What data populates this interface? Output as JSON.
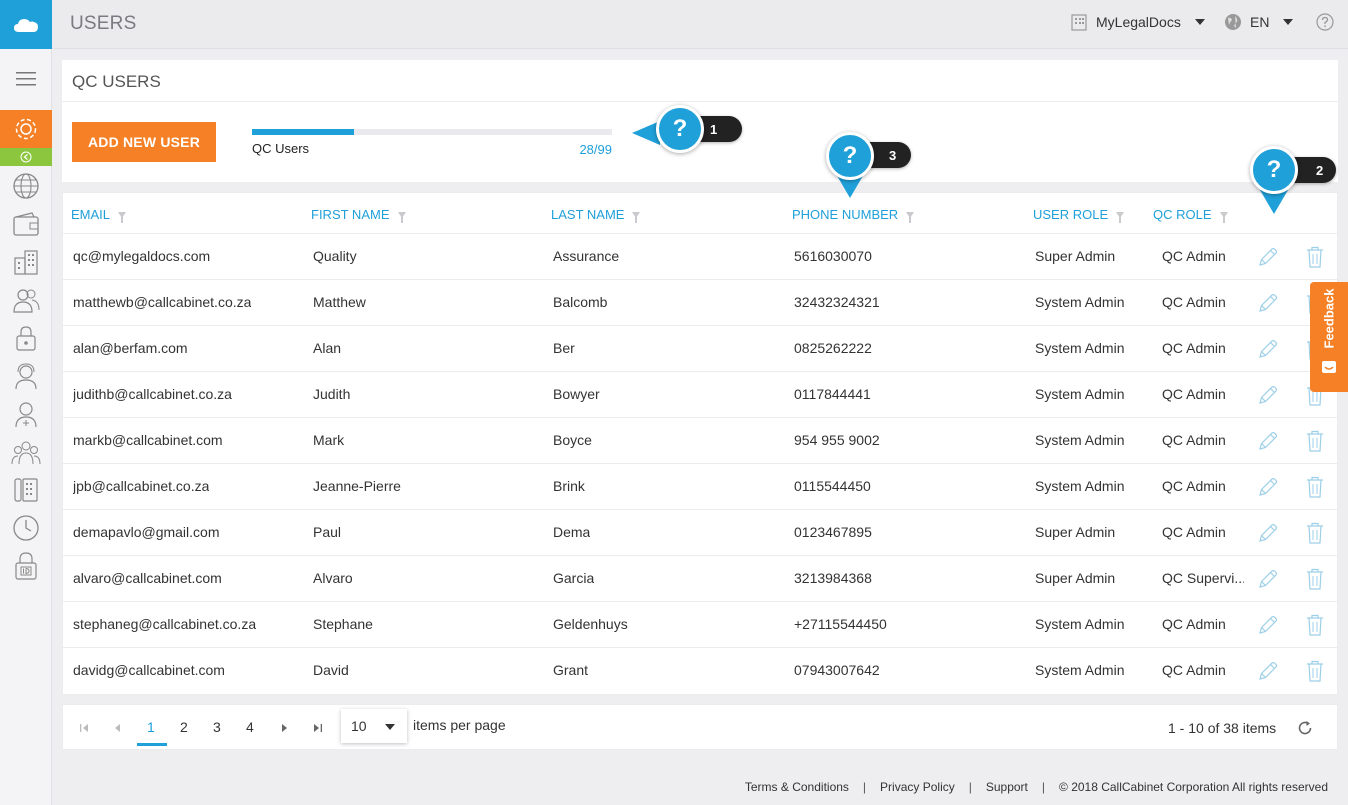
{
  "topbar": {
    "title": "USERS",
    "org": "MyLegalDocs",
    "language": "EN"
  },
  "panel": {
    "title": "QC USERS",
    "add_button": "ADD NEW USER",
    "progress_label": "QC Users",
    "progress_count": "28/99",
    "progress_used": 28,
    "progress_total": 99
  },
  "help": [
    {
      "number": "1",
      "glyph": "?"
    },
    {
      "number": "2",
      "glyph": "?"
    },
    {
      "number": "3",
      "glyph": "?"
    }
  ],
  "table": {
    "columns": [
      "EMAIL",
      "FIRST NAME",
      "LAST NAME",
      "PHONE NUMBER",
      "USER ROLE",
      "QC ROLE"
    ],
    "rows": [
      {
        "email": "qc@mylegaldocs.com",
        "first": "Quality",
        "last": "Assurance",
        "phone": "5616030070",
        "user_role": "Super Admin",
        "qc_role": "QC Admin"
      },
      {
        "email": "matthewb@callcabinet.co.za",
        "first": "Matthew",
        "last": "Balcomb",
        "phone": "32432324321",
        "user_role": "System Admin",
        "qc_role": "QC Admin"
      },
      {
        "email": "alan@berfam.com",
        "first": "Alan",
        "last": "Ber",
        "phone": "0825262222",
        "user_role": "System Admin",
        "qc_role": "QC Admin"
      },
      {
        "email": "judithb@callcabinet.co.za",
        "first": "Judith",
        "last": "Bowyer",
        "phone": "0117844441",
        "user_role": "System Admin",
        "qc_role": "QC Admin"
      },
      {
        "email": "markb@callcabinet.com",
        "first": "Mark",
        "last": "Boyce",
        "phone": "954 955 9002",
        "user_role": "System Admin",
        "qc_role": "QC Admin"
      },
      {
        "email": "jpb@callcabinet.co.za",
        "first": "Jeanne-Pierre",
        "last": "Brink",
        "phone": "0115544450",
        "user_role": "System Admin",
        "qc_role": "QC Admin"
      },
      {
        "email": "demapavlo@gmail.com",
        "first": "Paul",
        "last": "Dema",
        "phone": "0123467895",
        "user_role": "Super Admin",
        "qc_role": "QC Admin"
      },
      {
        "email": "alvaro@callcabinet.com",
        "first": "Alvaro",
        "last": "Garcia",
        "phone": "3213984368",
        "user_role": "Super Admin",
        "qc_role": "QC Supervi..."
      },
      {
        "email": "stephaneg@callcabinet.co.za",
        "first": "Stephane",
        "last": "Geldenhuys",
        "phone": "+27115544450",
        "user_role": "System Admin",
        "qc_role": "QC Admin"
      },
      {
        "email": "davidg@callcabinet.com",
        "first": "David",
        "last": "Grant",
        "phone": "07943007642",
        "user_role": "System Admin",
        "qc_role": "QC Admin"
      }
    ]
  },
  "pager": {
    "pages": [
      "1",
      "2",
      "3",
      "4"
    ],
    "current": "1",
    "per_page": "10",
    "per_page_label": "items per page",
    "summary": "1 - 10 of 38 items"
  },
  "footer": {
    "terms": "Terms & Conditions",
    "privacy": "Privacy Policy",
    "support": "Support",
    "copyright": "© 2018 CallCabinet Corporation All rights reserved",
    "separator": "|"
  },
  "feedback": {
    "label": "Feedback"
  },
  "colors": {
    "accent": "#1fa0d9",
    "orange": "#f58025",
    "green": "#8cc63f"
  }
}
